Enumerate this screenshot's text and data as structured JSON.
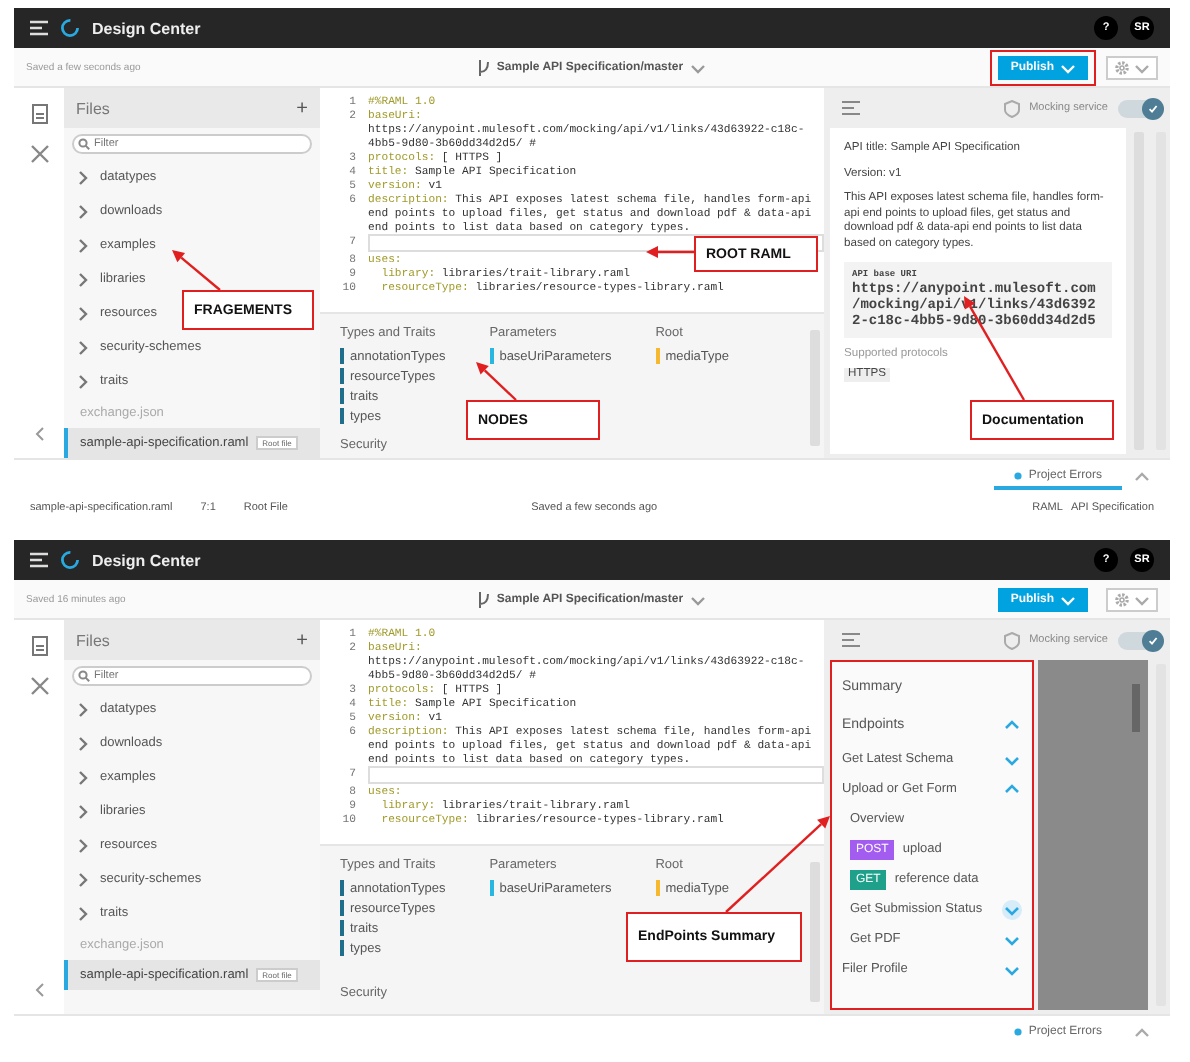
{
  "screens": [
    {
      "topbar": {
        "app_title": "Design Center",
        "help": "?",
        "avatar": "SR"
      },
      "saved_status": "Saved a few seconds ago",
      "branch": "Sample API Specification/master",
      "publish": {
        "label": "Publish",
        "highlighted": true
      },
      "files": {
        "title": "Files",
        "add": "+",
        "filter_placeholder": "Filter",
        "folders": [
          "datatypes",
          "downloads",
          "examples",
          "libraries",
          "resources",
          "security-schemes",
          "traits"
        ],
        "items": [
          {
            "name": "exchange.json",
            "selected": false
          },
          {
            "name": "sample-api-specification.raml",
            "selected": true,
            "badge": "Root file"
          }
        ],
        "callout": "FRAGEMENTS"
      },
      "code_lines": [
        {
          "number": "1",
          "key": "#%RAML 1.0"
        },
        {
          "number": "2",
          "key": "baseUri:",
          "value": " https://anypoint.mulesoft.com/mocking/api/v1/links/43d63922-c18c-4bb5-9d80-3b60dd34d2d5/ #"
        },
        {
          "number": "3",
          "key": "protocols:",
          "value": " [ HTTPS ]"
        },
        {
          "number": "4",
          "key": "title:",
          "value": " Sample API Specification"
        },
        {
          "number": "5",
          "key": "version:",
          "value": " v1"
        },
        {
          "number": "6",
          "key": "description:",
          "value": " This API exposes latest schema file, handles form-api end points to upload files, get status and download pdf & data-api end points to list data based on category types."
        },
        {
          "number": "7",
          "current": true
        },
        {
          "number": "8",
          "key": "uses:"
        },
        {
          "number": "9",
          "key": "  library:",
          "value": " libraries/trait-library.raml"
        },
        {
          "number": "10",
          "key": "  resourceType:",
          "value": " libraries/resource-types-library.raml"
        }
      ],
      "code_callout": "ROOT RAML",
      "nodes": {
        "groups": [
          {
            "title": "Types and Traits",
            "color": "#1f6e8c",
            "items": [
              "annotationTypes",
              "resourceTypes",
              "traits",
              "types"
            ]
          },
          {
            "title": "Parameters",
            "color": "#29b6e0",
            "items": [
              "baseUriParameters"
            ]
          },
          {
            "title": "Root",
            "color": "#f5b82e",
            "items": [
              "mediaType"
            ]
          }
        ],
        "security_title": "Security",
        "callout": "NODES"
      },
      "right_panel": {
        "kind": "documentation",
        "mocking_label": "Mocking service",
        "mocking_on": true,
        "highlighted": false,
        "api_title": "API title: Sample API Specification",
        "version": "Version: v1",
        "description": "This API exposes latest schema file, handles form-api end points to upload files, get status and download pdf & data-api end points to list data based on category types.",
        "base_uri_label": "API base URI",
        "base_uri": "https://anypoint.mulesoft.com/mocking/api/v1/links/43d63922-c18c-4bb5-9d80-3b60dd34d2d5",
        "protocols_label": "Supported protocols",
        "protocols": [
          "HTTPS"
        ],
        "callout": "Documentation"
      },
      "project_errors": {
        "label": "Project Errors",
        "selected": true
      },
      "status_bar": {
        "left": [
          "sample-api-specification.raml",
          "7:1",
          "Root File"
        ],
        "center": "Saved a few seconds ago",
        "right": [
          "RAML",
          "API Specification"
        ]
      }
    },
    {
      "topbar": {
        "app_title": "Design Center",
        "help": "?",
        "avatar": "SR"
      },
      "saved_status": "Saved 16 minutes ago",
      "branch": "Sample API Specification/master",
      "publish": {
        "label": "Publish",
        "highlighted": false
      },
      "files": {
        "title": "Files",
        "add": "+",
        "filter_placeholder": "Filter",
        "folders": [
          "datatypes",
          "downloads",
          "examples",
          "libraries",
          "resources",
          "security-schemes",
          "traits"
        ],
        "items": [
          {
            "name": "exchange.json",
            "selected": false
          },
          {
            "name": "sample-api-specification.raml",
            "selected": true,
            "badge": "Root file"
          }
        ]
      },
      "code_lines": [
        {
          "number": "1",
          "key": "#%RAML 1.0"
        },
        {
          "number": "2",
          "key": "baseUri:",
          "value": " https://anypoint.mulesoft.com/mocking/api/v1/links/43d63922-c18c-4bb5-9d80-3b60dd34d2d5/ #"
        },
        {
          "number": "3",
          "key": "protocols:",
          "value": " [ HTTPS ]"
        },
        {
          "number": "4",
          "key": "title:",
          "value": " Sample API Specification"
        },
        {
          "number": "5",
          "key": "version:",
          "value": " v1"
        },
        {
          "number": "6",
          "key": "description:",
          "value": " This API exposes latest schema file, handles form-api end points to upload files, get status and download pdf & data-api end points to list data based on category types."
        },
        {
          "number": "7",
          "current": true
        },
        {
          "number": "8",
          "key": "uses:"
        },
        {
          "number": "9",
          "key": "  library:",
          "value": " libraries/trait-library.raml"
        },
        {
          "number": "10",
          "key": "  resourceType:",
          "value": " libraries/resource-types-library.raml"
        }
      ],
      "nodes": {
        "groups": [
          {
            "title": "Types and Traits",
            "color": "#1f6e8c",
            "items": [
              "annotationTypes",
              "resourceTypes",
              "traits",
              "types"
            ]
          },
          {
            "title": "Parameters",
            "color": "#29b6e0",
            "items": [
              "baseUriParameters"
            ]
          },
          {
            "title": "Root",
            "color": "#f5b82e",
            "items": [
              "mediaType"
            ]
          }
        ],
        "security_title": "Security"
      },
      "right_panel": {
        "kind": "endpoints",
        "mocking_label": "Mocking service",
        "mocking_on": true,
        "highlighted": true,
        "items": [
          {
            "kind": "heading",
            "label": "Summary"
          },
          {
            "kind": "section",
            "label": "Endpoints",
            "expanded": true
          },
          {
            "kind": "resource",
            "label": "Get Latest Schema",
            "expanded": false
          },
          {
            "kind": "resource",
            "label": "Upload or Get Form",
            "expanded": true,
            "children": [
              {
                "kind": "link",
                "label": "Overview"
              },
              {
                "kind": "method",
                "method": "POST",
                "label": "upload",
                "color": "#a35cf0"
              },
              {
                "kind": "method",
                "method": "GET",
                "label": "reference data",
                "color": "#1fa08a"
              },
              {
                "kind": "resource",
                "label": "Get Submission Status",
                "expanded": false,
                "hovered": true
              },
              {
                "kind": "resource",
                "label": "Get PDF",
                "expanded": false
              }
            ]
          },
          {
            "kind": "resource",
            "label": "Filer Profile",
            "expanded": false
          }
        ],
        "callout": "EndPoints Summary"
      },
      "project_errors": {
        "label": "Project Errors",
        "selected": false
      }
    }
  ]
}
